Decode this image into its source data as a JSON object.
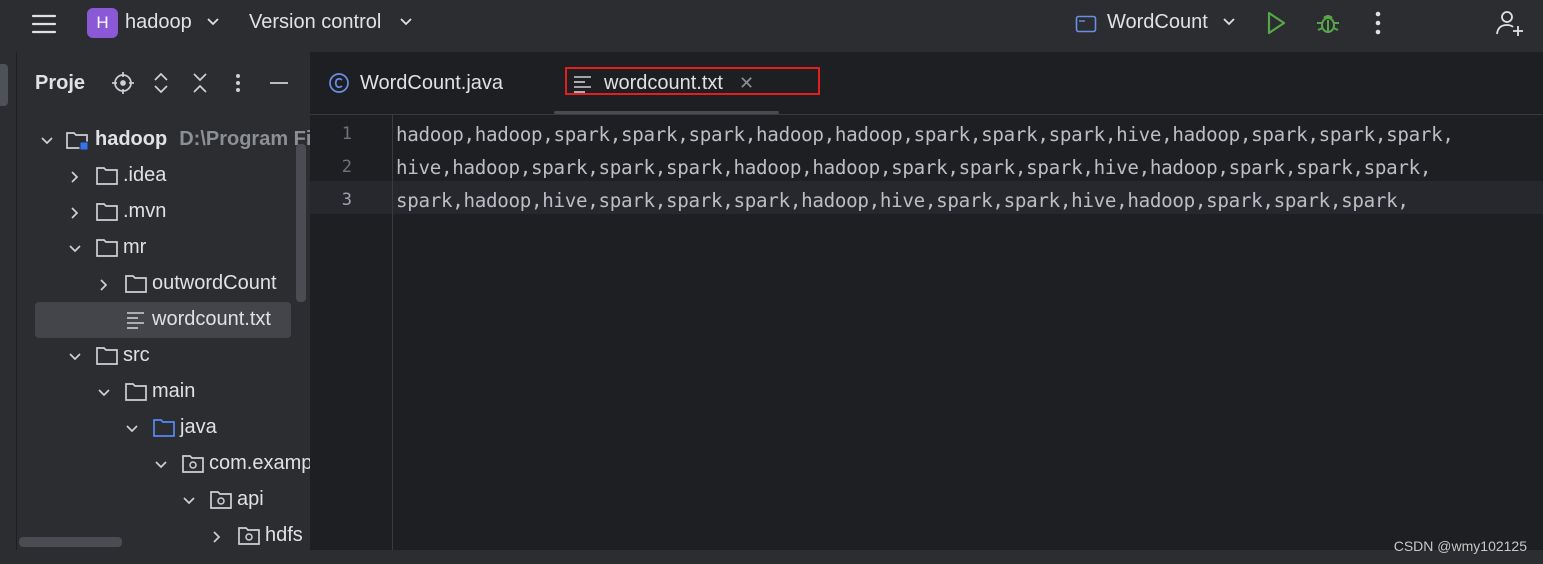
{
  "toolbar": {
    "project_badge": "H",
    "project_name": "hadoop",
    "version_control": "Version control",
    "run_config": "WordCount"
  },
  "project_panel": {
    "title": "Project",
    "tree": [
      {
        "label": "hadoop",
        "path": "D:\\Program Fil"
      },
      {
        "label": ".idea"
      },
      {
        "label": ".mvn"
      },
      {
        "label": "mr"
      },
      {
        "label": "outwordCount"
      },
      {
        "label": "wordcount.txt"
      },
      {
        "label": "src"
      },
      {
        "label": "main"
      },
      {
        "label": "java"
      },
      {
        "label": "com.examp"
      },
      {
        "label": "api"
      },
      {
        "label": "hdfs"
      }
    ]
  },
  "editor": {
    "tabs": [
      {
        "label": "WordCount.java"
      },
      {
        "label": "wordcount.txt"
      }
    ],
    "line_numbers": [
      "1",
      "2",
      "3"
    ],
    "lines": [
      "hadoop,hadoop,spark,spark,spark,hadoop,hadoop,spark,spark,spark,hive,hadoop,spark,spark,spark,",
      "hive,hadoop,spark,spark,spark,hadoop,hadoop,spark,spark,spark,hive,hadoop,spark,spark,spark,",
      "spark,hadoop,hive,spark,spark,spark,hadoop,hive,spark,spark,hive,hadoop,spark,spark,spark,"
    ]
  },
  "watermark": "CSDN @wmy102125"
}
